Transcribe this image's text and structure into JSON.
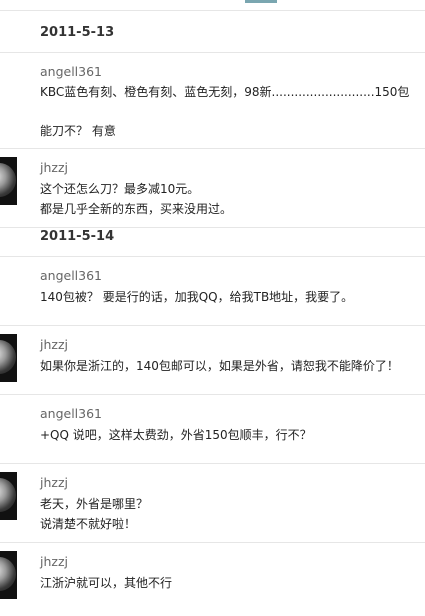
{
  "dates": [
    "2011-5-13",
    "2011-5-14"
  ],
  "messages": [
    {
      "user": "angell361",
      "lines": [
        "KBC蓝色有刻、橙色有刻、蓝色无刻，98新...........................150包",
        "能刀不？ 有意"
      ]
    },
    {
      "user": "jhzzj",
      "lines": [
        "这个还怎么刀？最多减10元。",
        "都是几乎全新的东西，买来没用过。"
      ]
    },
    {
      "user": "angell361",
      "lines": [
        "140包被？ 要是行的话，加我QQ，给我TB地址，我要了。"
      ]
    },
    {
      "user": "jhzzj",
      "lines": [
        "如果你是浙江的，140包邮可以，如果是外省，请恕我不能降价了！"
      ]
    },
    {
      "user": "angell361",
      "lines": [
        "+QQ 说吧，这样太费劲，外省150包顺丰，行不？"
      ]
    },
    {
      "user": "jhzzj",
      "lines": [
        "老天，外省是哪里？",
        "说清楚不就好啦！"
      ]
    },
    {
      "user": "jhzzj",
      "lines": [
        "江浙沪就可以，其他不行"
      ]
    }
  ]
}
